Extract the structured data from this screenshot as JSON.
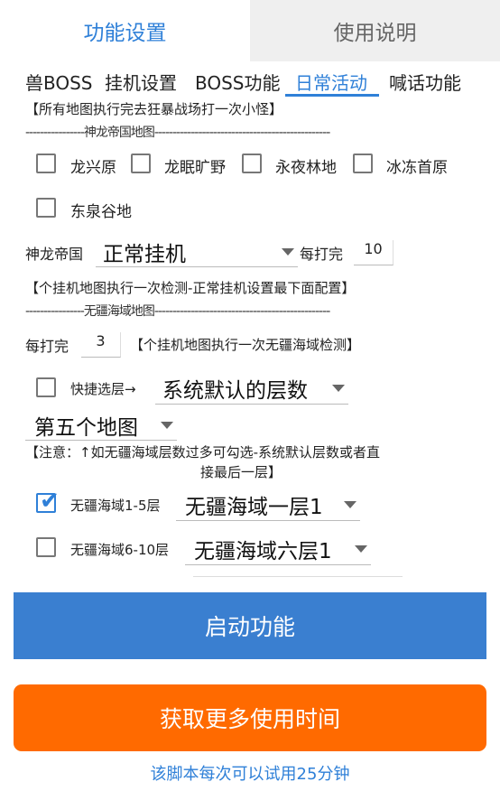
{
  "top_tabs": [
    "功能设置",
    "使用说明"
  ],
  "sub_tabs": [
    "兽BOSS",
    "挂机设置",
    "BOSS功能",
    "日常活动",
    "喊话功能"
  ],
  "notes": {
    "all_maps": "【所有地图执行完去狂暴战场打一次小怪】",
    "divider_shenlong": "----------------神龙帝国地图------------------------------------------------",
    "shenlong_hint": "【个挂机地图执行一次检测-正常挂机设置最下面配置】",
    "divider_wujiang": "----------------无疆海域地图------------------------------------------------",
    "wujiang_hint": "【个挂机地图执行一次无疆海域检测】",
    "warning_line1": "【注意：↑如无疆海域层数过多可勾选-系统默认层数或者直",
    "warning_line2": "接最后一层】"
  },
  "shenlong_maps": [
    {
      "label": "龙兴原",
      "checked": false
    },
    {
      "label": "龙眠旷野",
      "checked": false
    },
    {
      "label": "永夜林地",
      "checked": false
    },
    {
      "label": "冰冻首原",
      "checked": false
    },
    {
      "label": "东泉谷地",
      "checked": false
    }
  ],
  "shenlong_row": {
    "label": "神龙帝国",
    "mode": "正常挂机",
    "every_label": "每打完",
    "every_value": "10"
  },
  "wujiang_row": {
    "every_label": "每打完",
    "every_value": "3"
  },
  "quick_layer": {
    "label": "快捷选层→",
    "checked": false,
    "value": "系统默认的层数"
  },
  "map_select": {
    "value": "第五个地图"
  },
  "layers": [
    {
      "label": "无疆海域1-5层",
      "checked": true,
      "value": "无疆海域一层1"
    },
    {
      "label": "无疆海域6-10层",
      "checked": false,
      "value": "无疆海域六层1"
    }
  ],
  "buttons": {
    "start": "启动功能",
    "more_time": "获取更多使用时间"
  },
  "trial_text": "该脚本每次可以试用25分钟",
  "colors": {
    "accent": "#2f80d8",
    "start_button": "#3a7fd0",
    "more_button": "#ff6a00"
  }
}
